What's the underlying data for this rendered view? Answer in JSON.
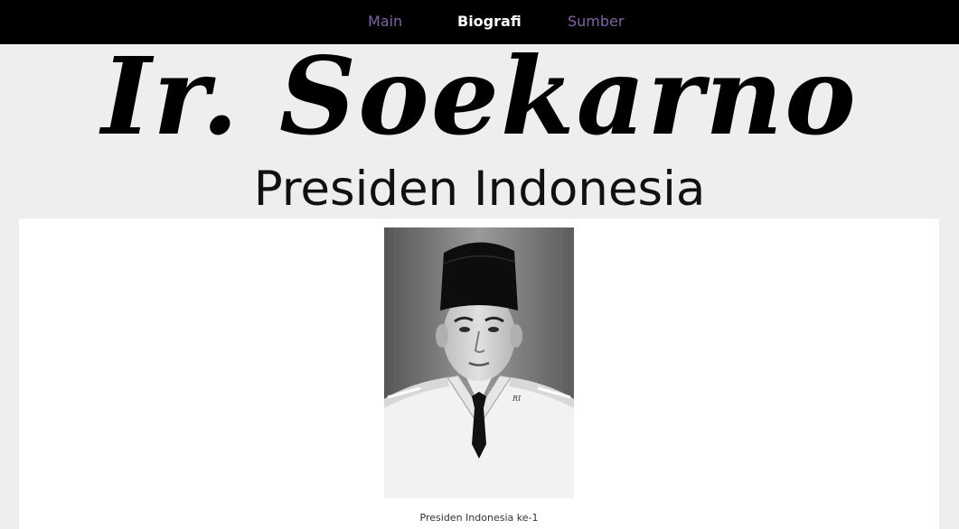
{
  "nav": {
    "links": [
      {
        "label": "Main",
        "active": false
      },
      {
        "label": "Biografi",
        "active": true
      },
      {
        "label": "Sumber",
        "active": false
      }
    ]
  },
  "hero": {
    "title": "Ir. Soekarno",
    "subtitle": "Presiden Indonesia"
  },
  "figure": {
    "caption": "Presiden Indonesia ke-1"
  },
  "colors": {
    "nav_background": "#000000",
    "nav_link": "#7f64a3",
    "nav_link_active": "#ffffff",
    "page_background": "#eeeeee",
    "card_background": "#ffffff"
  },
  "icons": {
    "portrait": "portrait-photo"
  }
}
